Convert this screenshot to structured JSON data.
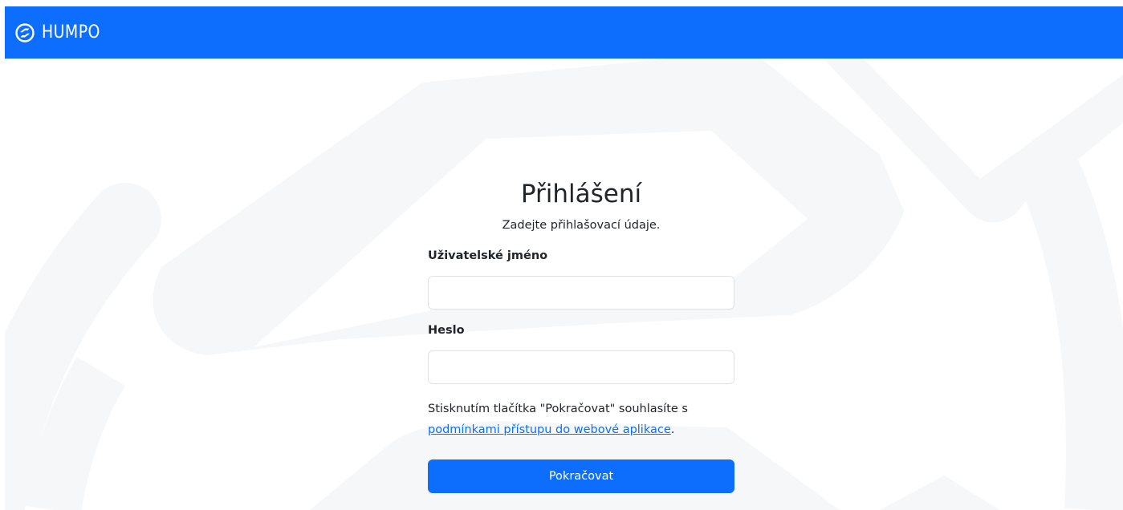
{
  "navbar": {
    "brand_name": "HUMPO",
    "brand_icon": "humpo-logo-icon"
  },
  "login": {
    "title": "Přihlášení",
    "subtitle": "Zadejte přihlašovací údaje.",
    "username_label": "Uživatelské jméno",
    "username_value": "",
    "password_label": "Heslo",
    "password_value": "",
    "terms_prefix": "Stisknutím tlačítka \"Pokračovat\" souhlasíte s ",
    "terms_link": "podmínkami přístupu do webové aplikace",
    "terms_suffix": ".",
    "submit_label": "Pokračovat"
  },
  "colors": {
    "primary": "#0d6efd",
    "text": "#212529",
    "input_border": "#dee2e6",
    "watermark": "#f6f7f9"
  }
}
